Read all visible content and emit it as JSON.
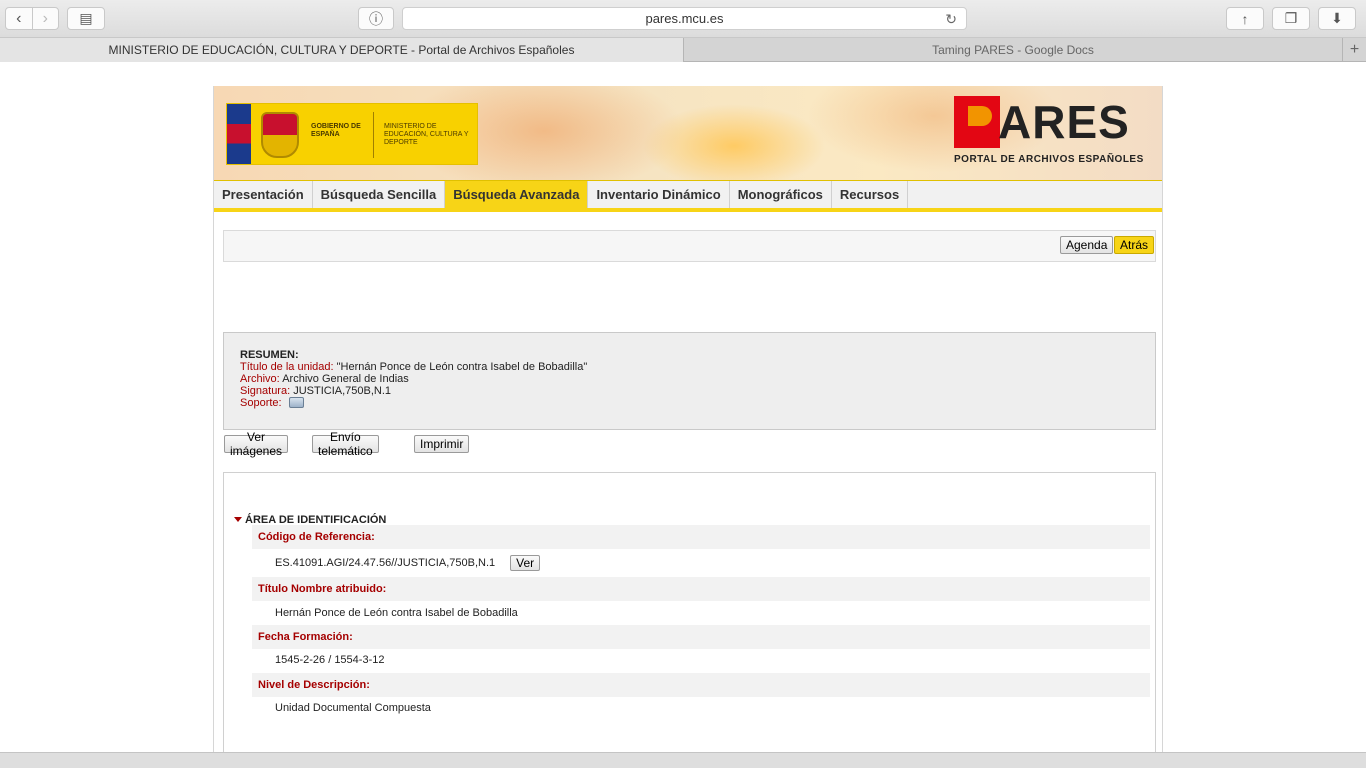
{
  "browser": {
    "url": "pares.mcu.es",
    "tabs": [
      {
        "label": "MINISTERIO DE EDUCACIÓN, CULTURA Y DEPORTE - Portal de Archivos Españoles",
        "active": true
      },
      {
        "label": "Taming PARES - Google Docs",
        "active": false
      }
    ]
  },
  "header": {
    "gov_label": "GOBIERNO DE ESPAÑA",
    "ministry_label": "MINISTERIO DE EDUCACIÓN, CULTURA Y DEPORTE",
    "logo_text": "ARES",
    "logo_subtitle": "PORTAL DE ARCHIVOS ESPAÑOLES"
  },
  "menu": {
    "items": [
      {
        "label": "Presentación"
      },
      {
        "label": "Búsqueda Sencilla"
      },
      {
        "label": "Búsqueda Avanzada",
        "active": true
      },
      {
        "label": "Inventario Dinámico"
      },
      {
        "label": "Monográficos"
      },
      {
        "label": "Recursos"
      }
    ]
  },
  "actions": {
    "agenda_label": "Agenda",
    "back_label": "Atrás"
  },
  "resumen": {
    "heading": "RESUMEN:",
    "titulo_label": "Título de la unidad:",
    "titulo_value": "\"Hernán Ponce de León contra Isabel de Bobadilla\"",
    "archivo_label": "Archivo:",
    "archivo_value": "Archivo General de Indias",
    "signatura_label": "Signatura:",
    "signatura_value": "JUSTICIA,750B,N.1",
    "soporte_label": "Soporte:"
  },
  "operations": {
    "ver_imagenes": "Ver imágenes",
    "envio": "Envío telemático",
    "imprimir": "Imprimir"
  },
  "area": {
    "title": "ÁREA DE IDENTIFICACIÓN",
    "fields": [
      {
        "label": "Código de Referencia:",
        "value": "ES.41091.AGI/24.47.56//JUSTICIA,750B,N.1",
        "button": "Ver"
      },
      {
        "label": "Título Nombre atribuido:",
        "value": "Hernán Ponce de León contra Isabel de Bobadilla"
      },
      {
        "label": "Fecha Formación:",
        "value": "1545-2-26 / 1554-3-12"
      },
      {
        "label": "Nivel de Descripción:",
        "value": "Unidad Documental Compuesta"
      }
    ]
  },
  "colors": {
    "accent_yellow": "#f7d417",
    "label_red": "#a50000"
  }
}
